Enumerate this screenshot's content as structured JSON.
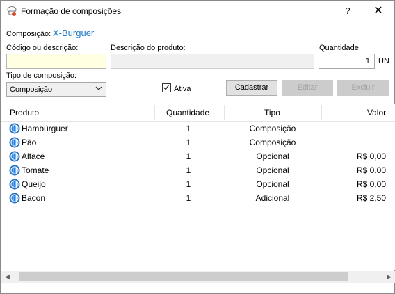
{
  "window": {
    "title": "Formação de composições",
    "help_label": "?",
    "close_label": "✕"
  },
  "composition": {
    "label": "Composição:",
    "value": "X-Burguer"
  },
  "form": {
    "code_label": "Código ou descrição:",
    "code_value": "",
    "description_label": "Descrição do produto:",
    "description_value": "",
    "quantity_label": "Quantidade",
    "quantity_value": "1",
    "unit": "UN",
    "type_label": "Tipo de composição:",
    "type_selected": "Composição",
    "active_label": "Ativa",
    "active_checked": true
  },
  "buttons": {
    "register": "Cadastrar",
    "edit": "Editar",
    "delete": "Excluir"
  },
  "table": {
    "columns": [
      "Produto",
      "Quantidade",
      "Tipo",
      "Valor"
    ],
    "rows": [
      {
        "produto": "Hambúrguer",
        "quantidade": "1",
        "tipo": "Composição",
        "valor": ""
      },
      {
        "produto": "Pão",
        "quantidade": "1",
        "tipo": "Composição",
        "valor": ""
      },
      {
        "produto": "Alface",
        "quantidade": "1",
        "tipo": "Opcional",
        "valor": "R$ 0,00"
      },
      {
        "produto": "Tomate",
        "quantidade": "1",
        "tipo": "Opcional",
        "valor": "R$ 0,00"
      },
      {
        "produto": "Queijo",
        "quantidade": "1",
        "tipo": "Opcional",
        "valor": "R$ 0,00"
      },
      {
        "produto": "Bacon",
        "quantidade": "1",
        "tipo": "Adicional",
        "valor": "R$ 2,50"
      }
    ]
  },
  "icons": {
    "app": "chef-hat-icon",
    "row": "cutlery-icon",
    "select": "chevron-down-icon",
    "scroll_left": "scroll-left-arrow-icon",
    "scroll_right": "scroll-right-arrow-icon"
  },
  "colors": {
    "accent": "#1e78c8",
    "input_highlight": "#ffffe1",
    "row_icon": "#1e6fc8"
  }
}
